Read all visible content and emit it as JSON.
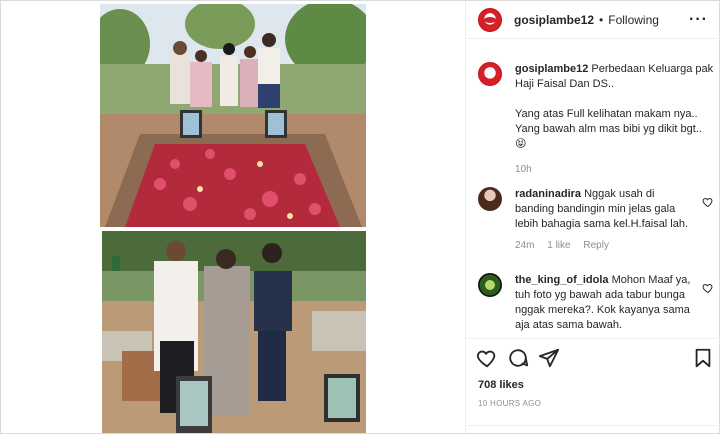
{
  "post": {
    "username": "gosiplambe12",
    "separator": "•",
    "follow_status": "Following",
    "more_icon": "more-horizontal-icon"
  },
  "caption": {
    "username": "gosiplambe12",
    "text_line1": "Perbedaan Keluarga pak Haji Faisal Dan DS..",
    "text_line2": "Yang atas Full kelihatan makam nya.. Yang bawah alm mas bibi yg dikit bgt..",
    "emoji": "😝",
    "time": "10h"
  },
  "comments": [
    {
      "username": "radaninadira",
      "text": "Nggak usah di banding bandingin min jelas gala lebih bahagia sama kel.H.faisal lah.",
      "time": "24m",
      "likes": "1 like",
      "reply": "Reply"
    },
    {
      "username": "the_king_of_idola",
      "text": "Mohon Maaf ya, tuh foto yg bawah ada tabur bunga nggak mereka?. Kok kayanya sama aja atas sama bawah."
    }
  ],
  "actions": {
    "likes": "708 likes",
    "timestamp": "10 HOURS AGO"
  },
  "colors": {
    "brand_red": "#d5202a",
    "text": "#262626",
    "muted": "#8e8e8e",
    "border": "#efefef"
  }
}
